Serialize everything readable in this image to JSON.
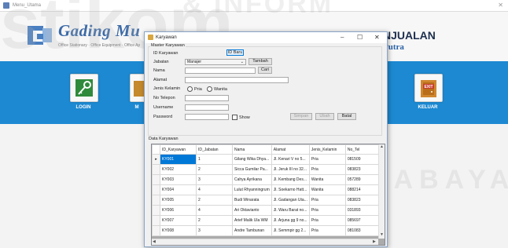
{
  "main_window": {
    "title": "Menu_Utama",
    "brand_name": "Gading Mu",
    "brand_tagline": "Office Stationary · Office Equipment · Office Ap",
    "header_title": "NJUALAN",
    "header_subtitle": "Putra",
    "menu": [
      {
        "label": "LOGIN",
        "icon": "key-icon"
      },
      {
        "label": "M",
        "icon": "folder-icon"
      },
      {
        "label": "KELUAR",
        "icon": "exit-door-icon"
      }
    ]
  },
  "watermark": {
    "line1": "stikom",
    "line2": "& INFORM",
    "line3": "RABAYA"
  },
  "dialog": {
    "title": "Karyawan",
    "group_label": "Master Karyawan",
    "fields": {
      "id_label": "ID Karyawan",
      "id_button": "ID Baru",
      "jabatan_label": "Jabatan",
      "jabatan_value": "Manajer",
      "tambah_button": "Tambah",
      "nama_label": "Nama",
      "cari_button": "Cari",
      "alamat_label": "Alamat",
      "jk_label": "Jenis Kelamin",
      "jk_options": [
        "Pria",
        "Wanita"
      ],
      "telp_label": "No Telepon",
      "username_label": "Username",
      "password_label": "Password",
      "show_label": "Show"
    },
    "buttons": {
      "simpan": "Simpan",
      "ubah": "Ubah",
      "batal": "Batal"
    },
    "grid_label": "Data Karyawan",
    "grid": {
      "columns": [
        "ID_Karyawan",
        "ID_Jabatan",
        "Nama",
        "Alamat",
        "Jenis_Kelamin",
        "No_Tel"
      ],
      "rows": [
        [
          "KY001",
          "1",
          "Gilang Wika Dhya...",
          "Jl. Kenari V no 5...",
          "Pria",
          "081509"
        ],
        [
          "KY002",
          "2",
          "Sicca Gumilar Pa...",
          "Jl. Jeruk III no 32...",
          "Pria",
          "083823"
        ],
        [
          "KY003",
          "3",
          "Cahya Ayrikana",
          "Jl. Kembang Des...",
          "Wanita",
          "057289"
        ],
        [
          "KY004",
          "4",
          "Lulut Rhyanningrum",
          "Jl. Soekarno Hatt...",
          "Wanita",
          "088214"
        ],
        [
          "KY005",
          "2",
          "Budi Winarata",
          "Jl. Gadangan Uta...",
          "Pria",
          "083823"
        ],
        [
          "KY006",
          "4",
          "Ari Oktavianto",
          "Jl. Waru Barat no...",
          "Pria",
          "031893"
        ],
        [
          "KY007",
          "2",
          "Arief Malik Ula WM",
          "Jl. Arjuna gg 9 no...",
          "Pria",
          "085697"
        ],
        [
          "KY008",
          "3",
          "Andre Tambunan",
          "Jl. Semmpir gg 2...",
          "Pria",
          "081083"
        ]
      ]
    }
  }
}
